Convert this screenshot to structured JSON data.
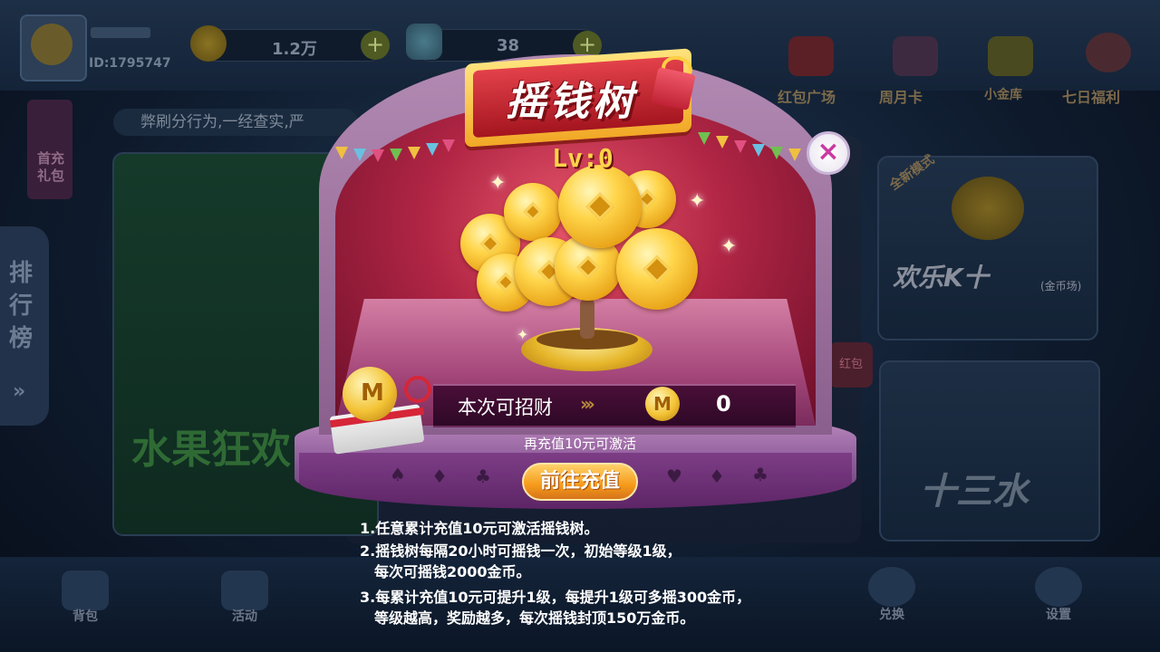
{
  "lobby": {
    "player_id": "ID:1795747",
    "coins": "1.2万",
    "diamonds": "38",
    "top_nav": [
      "红包广场",
      "周月卡",
      "小金库",
      "七日福利"
    ],
    "notice": "弊刷分行为,一经查实,严",
    "first_charge": "首充礼包",
    "ranking": "排行榜",
    "games": {
      "fruit": "水果狂欢",
      "k10": "欢乐K十",
      "k10_sub": "(金币场)",
      "k10_tag": "全新模式",
      "s13": "十三水",
      "hongbao": "红包"
    },
    "bottom_nav": [
      "背包",
      "活动",
      "兑换",
      "设置"
    ]
  },
  "popup": {
    "title": "摇钱树",
    "level": "Lv:0",
    "close": "×",
    "bar_label": "本次可招财",
    "bar_arrows": "›››",
    "bar_icon": "M",
    "bar_value": "0",
    "hint": "再充值10元可激活",
    "recharge_button": "前往充值",
    "rules": [
      "1.任意累计充值10元可激活摇钱树。",
      "2.摇钱树每隔20小时可摇钱一次，初始等级1级，",
      "  每次可摇钱2000金币。",
      "3.每累计充值10元可提升1级，每提升1级可多摇300金币，",
      "  等级越高，奖励越多，每次摇钱封顶150万金币。"
    ]
  },
  "colors": {
    "gold": "#ffd34a",
    "popup_red": "#b02544",
    "dome_purple": "#a77aa8",
    "close_icon": "#c83aa0"
  }
}
